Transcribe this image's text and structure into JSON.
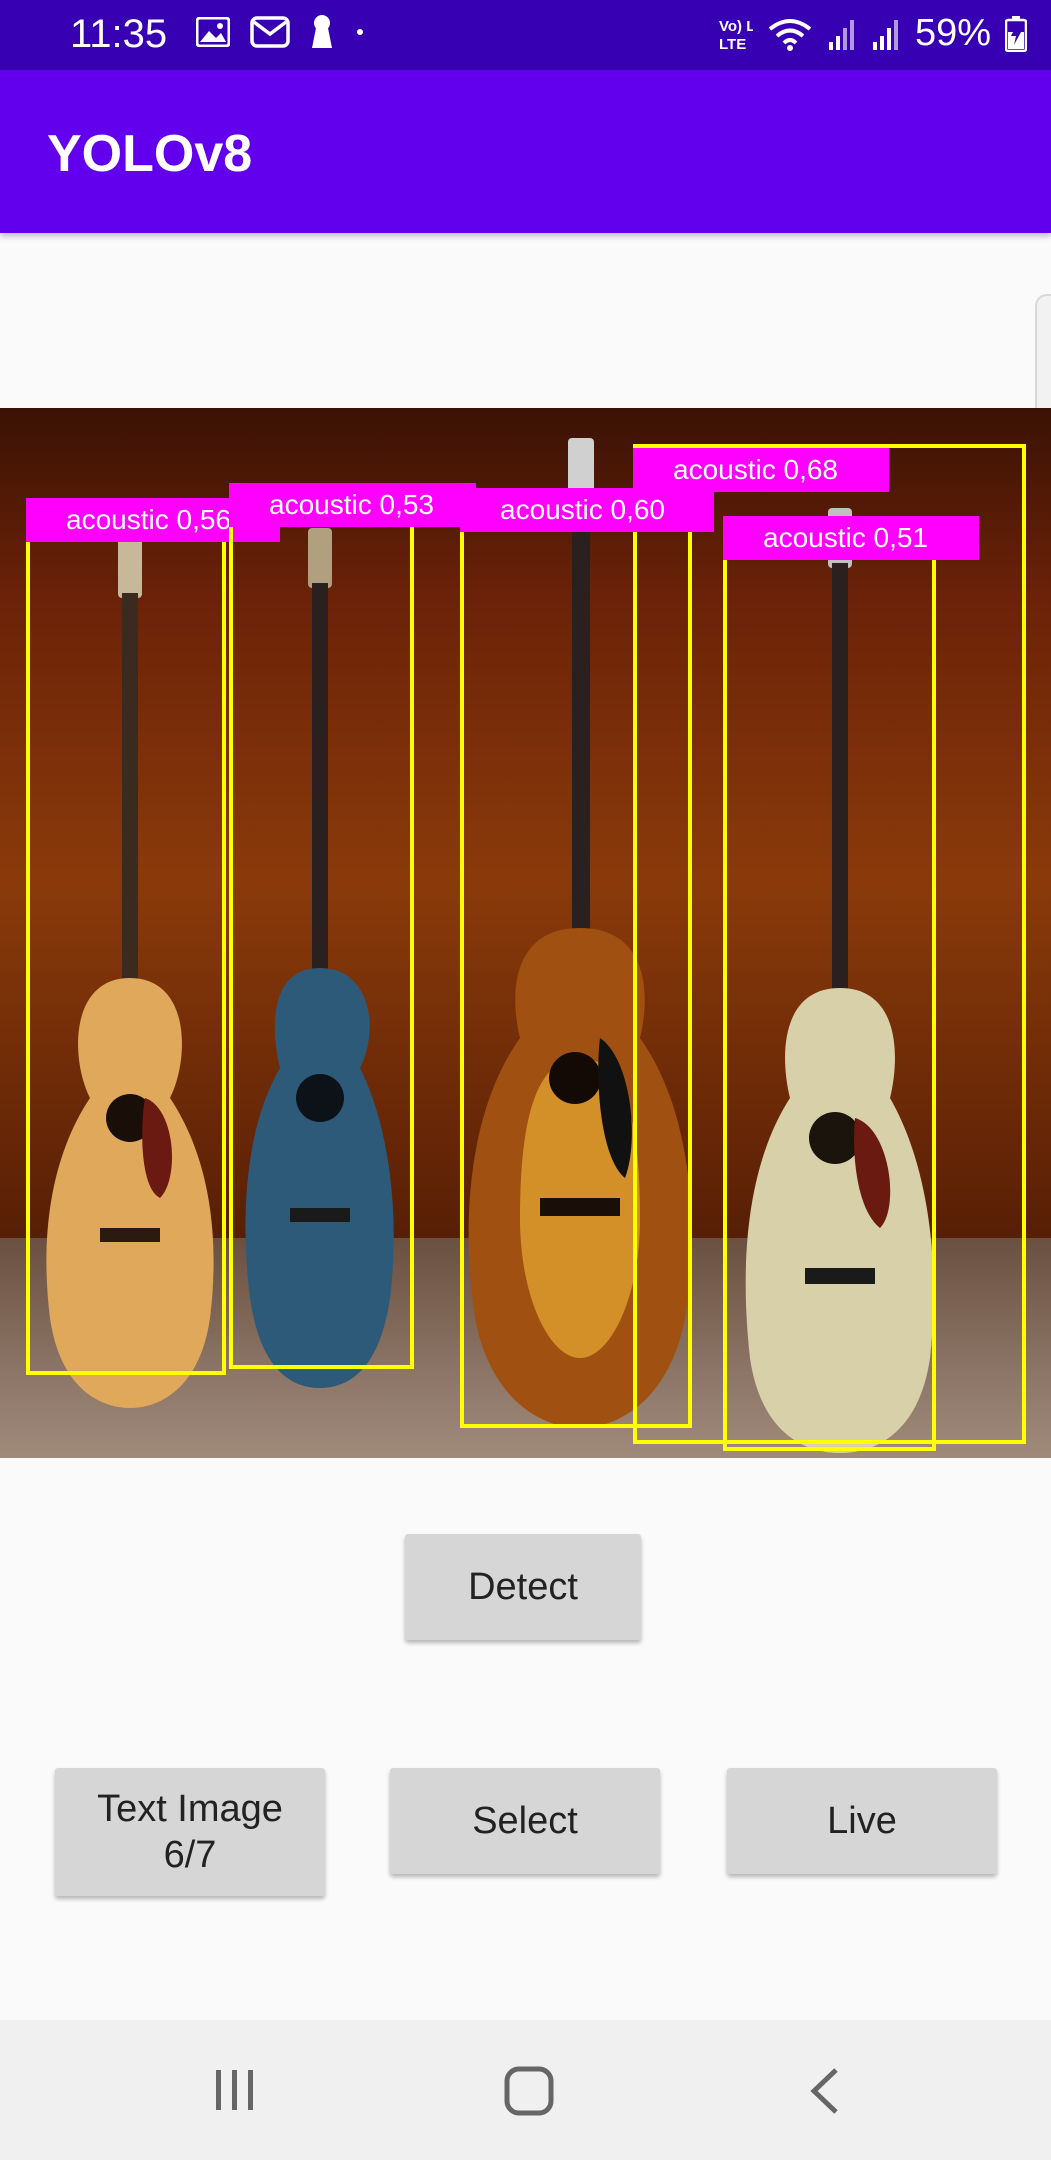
{
  "status_bar": {
    "time": "11:35",
    "network": "Vo) LTE",
    "battery": "59%"
  },
  "app_bar": {
    "title": "YOLOv8"
  },
  "detections": [
    {
      "label": "acoustic 0,56"
    },
    {
      "label": "acoustic 0,53"
    },
    {
      "label": "acoustic 0,60"
    },
    {
      "label": "acoustic 0,68"
    },
    {
      "label": "acoustic 0,51"
    }
  ],
  "buttons": {
    "detect": "Detect",
    "text_image_line1": "Text Image",
    "text_image_line2": "6/7",
    "select": "Select",
    "live": "Live"
  },
  "colors": {
    "status_bar": "#3700b3",
    "app_bar": "#6200ee",
    "box_border": "#ffff00",
    "label_bg": "#ff00ff"
  }
}
